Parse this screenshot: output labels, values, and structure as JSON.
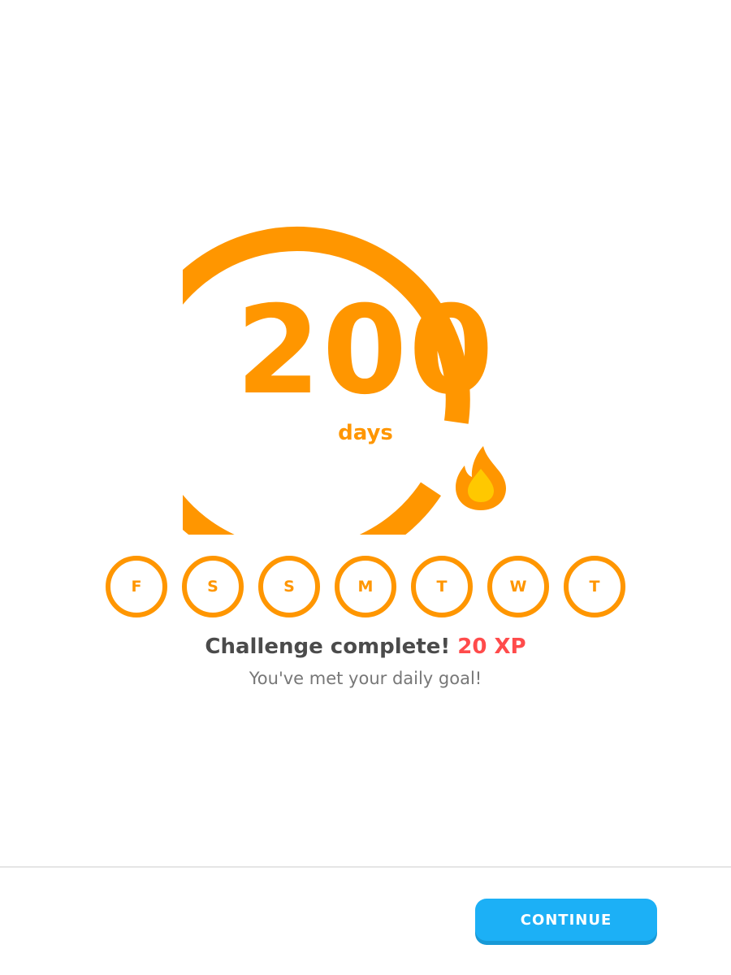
{
  "streak": {
    "count": "200",
    "unit": "days",
    "icon": "flame-icon"
  },
  "week": {
    "days": [
      {
        "letter": "F"
      },
      {
        "letter": "S"
      },
      {
        "letter": "S"
      },
      {
        "letter": "M"
      },
      {
        "letter": "T"
      },
      {
        "letter": "W"
      },
      {
        "letter": "T"
      }
    ]
  },
  "message": {
    "headline": "Challenge complete!",
    "xp": "20 XP",
    "subline": "You've met your daily goal!"
  },
  "footer": {
    "continue_label": "CONTINUE"
  },
  "colors": {
    "streak_orange": "#ff9600",
    "xp_red": "#ff4b4b",
    "button_blue": "#1cb0f6",
    "flame_yellow": "#ffc800"
  }
}
